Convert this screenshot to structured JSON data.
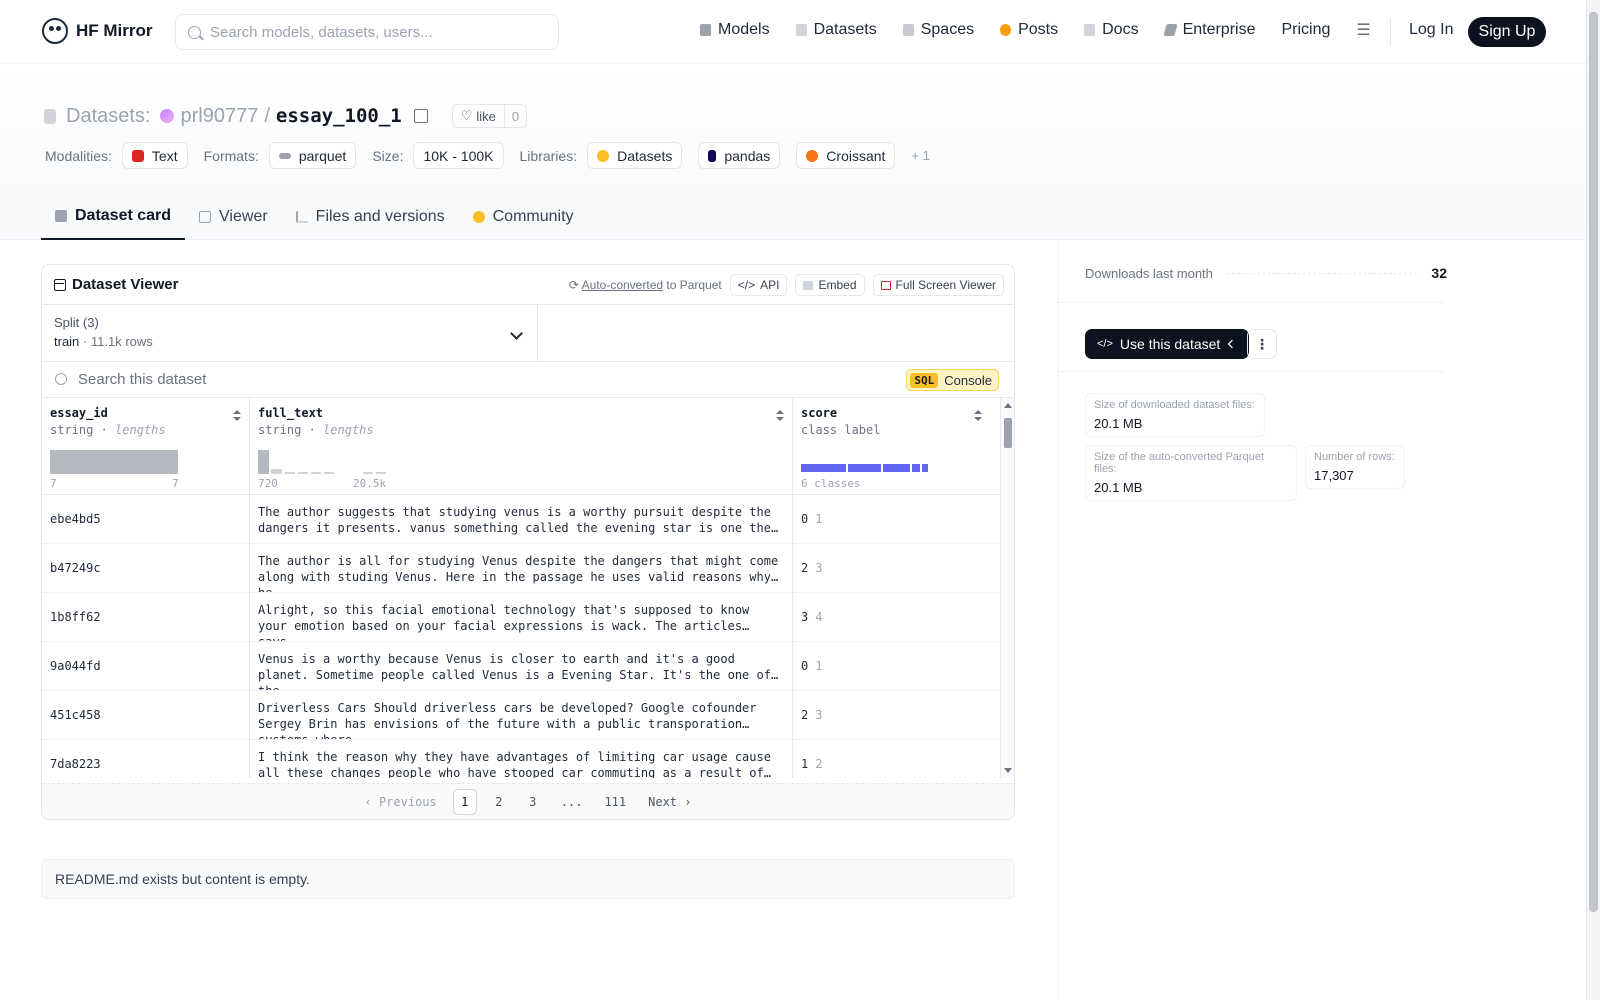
{
  "nav": {
    "brand": "HF Mirror",
    "search_placeholder": "Search models, datasets, users...",
    "links": [
      "Models",
      "Datasets",
      "Spaces",
      "Posts",
      "Docs",
      "Enterprise",
      "Pricing"
    ],
    "login": "Log In",
    "signup": "Sign Up"
  },
  "header": {
    "section": "Datasets:",
    "owner": "prl90777",
    "sep": "/",
    "name": "essay_100_1",
    "like_label": "like",
    "like_count": "0",
    "modalities_label": "Modalities:",
    "modality": "Text",
    "formats_label": "Formats:",
    "format": "parquet",
    "size_label": "Size:",
    "size": "10K - 100K",
    "libraries_label": "Libraries:",
    "libraries": [
      "Datasets",
      "pandas",
      "Croissant"
    ],
    "libraries_more": "+ 1"
  },
  "tabs": [
    "Dataset card",
    "Viewer",
    "Files and versions",
    "Community"
  ],
  "viewer": {
    "title": "Dataset Viewer",
    "auto_link": "Auto-converted",
    "auto_rest": "to Parquet",
    "api": "API",
    "embed": "Embed",
    "fullscreen": "Full Screen Viewer",
    "split_label": "Split (3)",
    "split_name": "train",
    "split_rows": "11.1k rows",
    "search_placeholder": "Search this dataset",
    "sql": "SQL",
    "console": "Console",
    "columns": [
      {
        "name": "essay_id",
        "type": "string",
        "stat": "lengths",
        "min": "7",
        "max": "7"
      },
      {
        "name": "full_text",
        "type": "string",
        "stat": "lengths",
        "min": "720",
        "max": "20.5k"
      },
      {
        "name": "score",
        "type": "class label",
        "stat": "",
        "min": "6 classes",
        "max": ""
      }
    ],
    "rows": [
      {
        "id": "ebe4bd5",
        "text": "The author suggests that studying venus is a worthy pursuit despite the dangers it presents. vanus something called the evening star is one the…",
        "score": "0",
        "label": "1"
      },
      {
        "id": "b47249c",
        "text": "The author is all for studying Venus despite the dangers that might come along with studing Venus. Here in the passage he uses valid reasons why he…",
        "score": "2",
        "label": "3"
      },
      {
        "id": "1b8ff62",
        "text": "Alright, so this facial emotional technology that's supposed to know your emotion based on your facial expressions is wack. The articles says…",
        "score": "3",
        "label": "4"
      },
      {
        "id": "9a044fd",
        "text": "Venus is a worthy because Venus is closer to earth and it's a good planet. Sometime people called Venus is a Evening Star. It's the one of the…",
        "score": "0",
        "label": "1"
      },
      {
        "id": "451c458",
        "text": "Driverless Cars Should driverless cars be developed? Google cofounder Sergey Brin has envisions of the future with a public transporation systems where…",
        "score": "2",
        "label": "3"
      },
      {
        "id": "7da8223",
        "text": "I think the reason why they have advantages of limiting car usage cause all these changes people who have stooped car commuting as a result of the…",
        "score": "1",
        "label": "2"
      }
    ],
    "pager": {
      "prev": "Previous",
      "pages": [
        "1",
        "2",
        "3",
        "...",
        "111"
      ],
      "next": "Next"
    }
  },
  "readme": "README.md exists but content is empty.",
  "sidebar": {
    "downloads_label": "Downloads last month",
    "downloads": "32",
    "use_button": "Use this dataset",
    "stats": [
      {
        "label": "Size of downloaded dataset files:",
        "value": "20.1 MB"
      },
      {
        "label": "Size of the auto-converted Parquet files:",
        "value": "20.1 MB"
      },
      {
        "label": "Number of rows:",
        "value": "17,307"
      }
    ]
  },
  "colors": {
    "accent": "#6366f1",
    "dark": "#0b1220",
    "sql": "#fbbf24"
  }
}
